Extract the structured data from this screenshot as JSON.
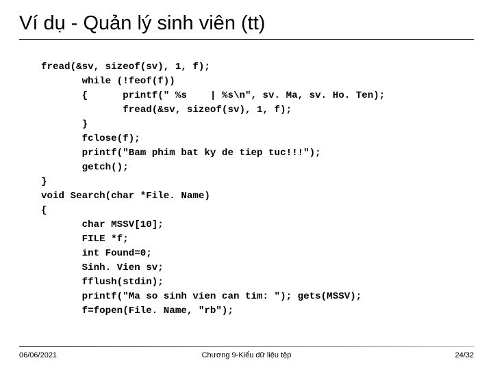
{
  "title": "Ví dụ - Quản lý sinh viên (tt)",
  "code": "fread(&sv, sizeof(sv), 1, f);\n       while (!feof(f))\n       {      printf(\" %s    | %s\\n\", sv. Ma, sv. Ho. Ten);\n              fread(&sv, sizeof(sv), 1, f);\n       }\n       fclose(f);\n       printf(\"Bam phim bat ky de tiep tuc!!!\");\n       getch();\n}\nvoid Search(char *File. Name)\n{\n       char MSSV[10];\n       FILE *f;\n       int Found=0;\n       Sinh. Vien sv;\n       fflush(stdin);\n       printf(\"Ma so sinh vien can tim: \"); gets(MSSV);\n       f=fopen(File. Name, \"rb\");",
  "footer": {
    "left": "06/06/2021",
    "center": "Chương 9-Kiểu dữ liệu tệp",
    "right": "24/32"
  }
}
